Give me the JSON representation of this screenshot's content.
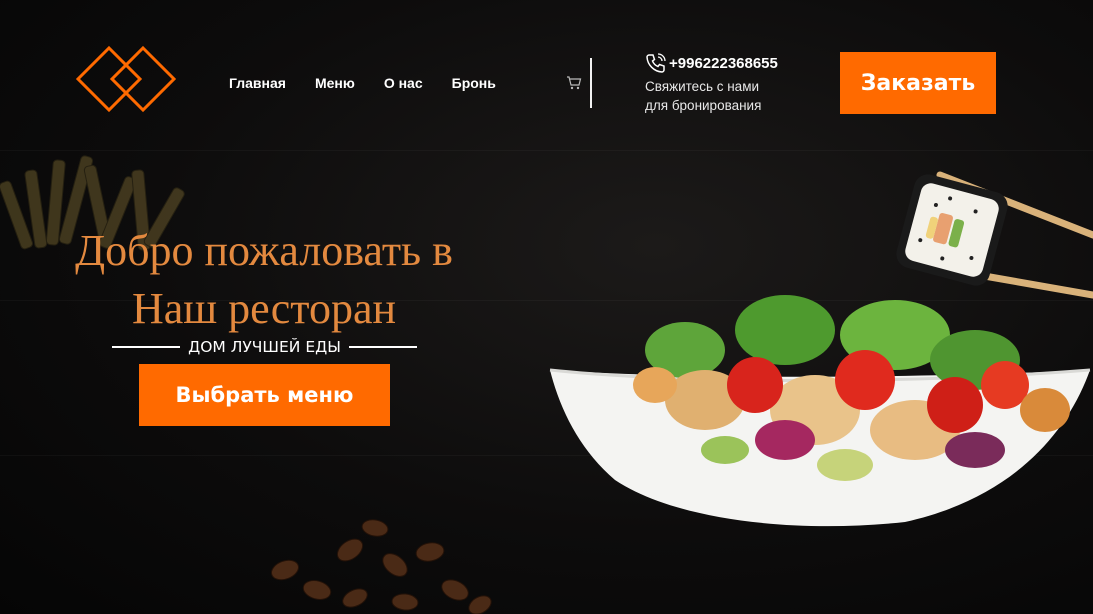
{
  "header": {
    "nav": [
      "Главная",
      "Меню",
      "О нас",
      "Бронь"
    ],
    "phone": "+996222368655",
    "contact_lines": [
      "Свяжитесь с нами",
      "для бронирования"
    ],
    "order_button": "Заказать"
  },
  "hero": {
    "title_line1": "Добро пожаловать в",
    "title_line2": "Наш ресторан",
    "subtitle": "ДОМ ЛУЧШЕЙ ЕДЫ",
    "cta_button": "Выбрать меню"
  },
  "icons": {
    "logo": "diamond-logo-icon",
    "cart": "cart-icon",
    "phone": "phone-icon"
  },
  "colors": {
    "accent": "#ff6a00",
    "title": "#e3893f",
    "background": "#0d0c0c",
    "text": "#ffffff"
  }
}
